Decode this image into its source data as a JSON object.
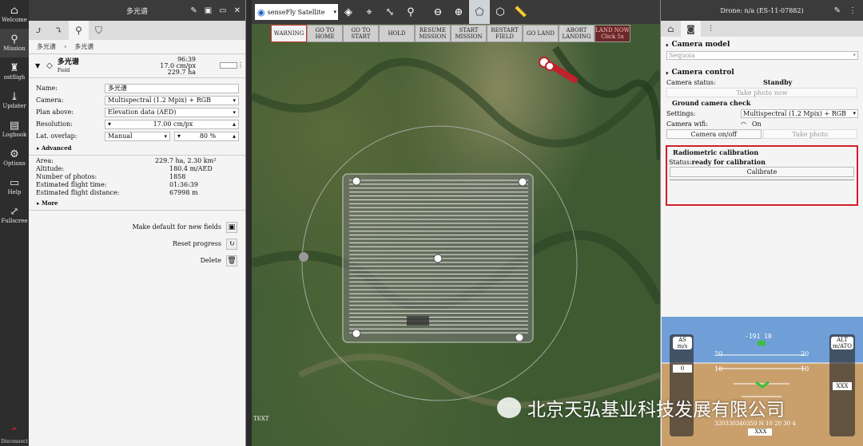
{
  "nav": [
    {
      "label": "Welcome",
      "icon": "home-icon",
      "glyph": "⌂"
    },
    {
      "label": "Mission",
      "icon": "mission-icon",
      "glyph": "⚲"
    },
    {
      "label": "ostfligh",
      "icon": "postflight-icon",
      "glyph": "♜"
    },
    {
      "label": "Updater",
      "icon": "updater-icon",
      "glyph": "⤓"
    },
    {
      "label": "Logbook",
      "icon": "logbook-icon",
      "glyph": "▤"
    },
    {
      "label": "Options",
      "icon": "options-gear-icon",
      "glyph": "⚙"
    },
    {
      "label": "Help",
      "icon": "help-book-icon",
      "glyph": "▭"
    },
    {
      "label": "Fullscree",
      "icon": "fullscreen-icon",
      "glyph": "⤢"
    }
  ],
  "nav_bottom": "Disconnect",
  "left": {
    "title": "多光谱",
    "breadcrumb": [
      "多光谱",
      "多光谱"
    ],
    "field_name": "多光谱",
    "field_type": "Field",
    "stats": [
      "96:39",
      "17.0 cm/px",
      "229.7 ha"
    ],
    "rows": [
      {
        "label": "Name:",
        "value": "多光谱"
      },
      {
        "label": "Camera:",
        "value": "Multispectral (1.2 Mpix) + RGB"
      },
      {
        "label": "Plan above:",
        "value": "Elevation data (AED)"
      },
      {
        "label": "Resolution:",
        "value": "17.00 cm/px"
      },
      {
        "label": "Lat. overlap:",
        "value": "Manual",
        "value2": "80 %"
      }
    ],
    "advanced": "Advanced",
    "summary": [
      {
        "label": "Area:",
        "value": "229.7 ha, 2.30 km²"
      },
      {
        "label": "Altitude:",
        "value": "180.4 m/AED"
      },
      {
        "label": "Number of photos:",
        "value": "1858"
      },
      {
        "label": "Estimated flight time:",
        "value": "01:36:39"
      },
      {
        "label": "Estimated flight distance:",
        "value": "67998 m"
      }
    ],
    "more": "More",
    "actions": [
      "Make default for new fields",
      "Reset progress",
      "Delete"
    ]
  },
  "map": {
    "layer": "senseFly Satellite",
    "commands": [
      "WARNING",
      "GO TO HOME",
      "GO TO START",
      "HOLD",
      "RESUME MISSION",
      "START MISSION",
      "RESTART FIELD",
      "GO LAND",
      "ABORT LANDING",
      "LAND NOW Click 5x"
    ],
    "corner_text": "TEXT"
  },
  "right": {
    "title": "Drone: n/a (ES-11-07882)",
    "camera_model_title": "Camera model",
    "camera_model": "Sequoia",
    "camera_control_title": "Camera control",
    "camera_status_label": "Camera status:",
    "camera_status": "Standby",
    "take_photo_now": "Take photo now",
    "ground_check": "Ground camera check",
    "settings_label": "Settings:",
    "settings_value": "Multispectral (1.2 Mpix) + RGB",
    "wifi_label": "Camera wifi:",
    "wifi_value": "On",
    "camera_onoff": "Camera on/off",
    "take_photo": "Take photo",
    "radiometric_title": "Radiometric calibration",
    "radiometric_status_label": "Status:",
    "radiometric_status": "ready for calibration",
    "calibrate": "Calibrate"
  },
  "hud": {
    "heading": "-191",
    "heading_unit": "10",
    "as_label": "AS",
    "as_unit": "m/s",
    "as_value": "0",
    "alt_label": "ALT",
    "alt_unit": "m/ATO",
    "pitch_labels": [
      "20",
      "10"
    ],
    "compass": "320330340350 N 10 20 30 4",
    "xxx": "XXX"
  },
  "watermark": "北京天弘基业科技发展有限公司"
}
